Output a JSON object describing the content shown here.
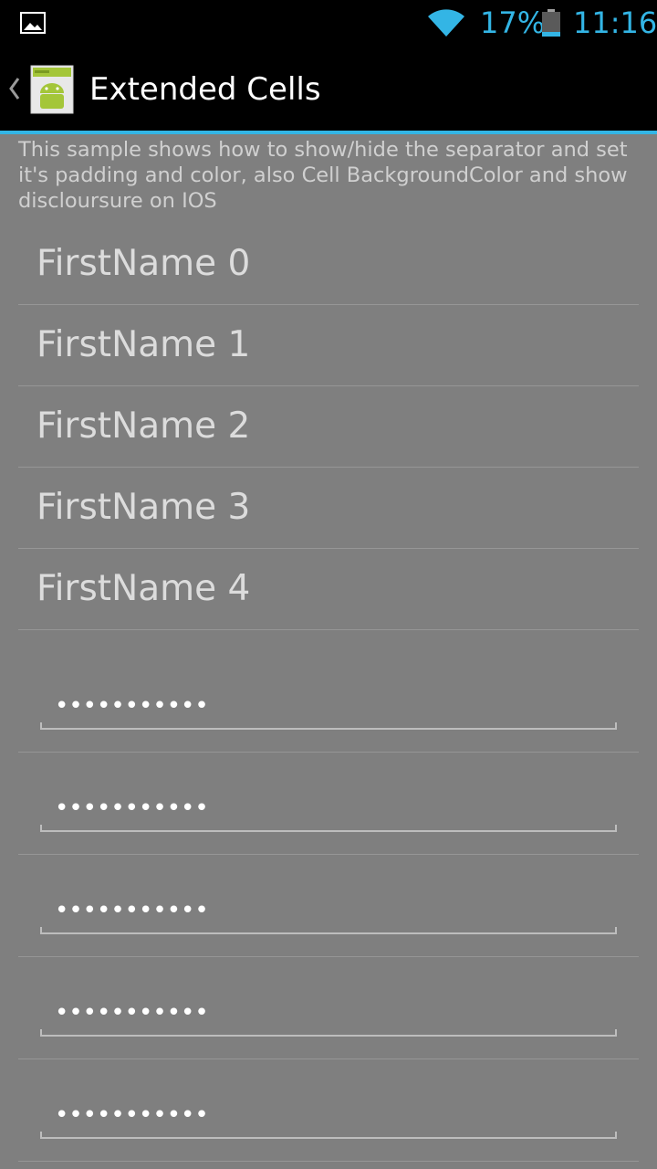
{
  "status_bar": {
    "left_icon": "image-icon",
    "wifi_icon": "wifi-icon",
    "battery_percent": "17%",
    "battery_icon": "battery-icon",
    "battery_level": 0.17,
    "time": "11:16",
    "accent_color": "#33b5e5"
  },
  "action_bar": {
    "up_icon": "chevron-left-icon",
    "app_icon": "android-app-icon",
    "title": "Extended Cells"
  },
  "description": "This sample shows how to show/hide the separator and set it's padding and color, also Cell BackgroundColor and show discloursure on IOS",
  "name_rows": [
    {
      "label": "FirstName 0"
    },
    {
      "label": "FirstName 1"
    },
    {
      "label": "FirstName 2"
    },
    {
      "label": "FirstName 3"
    },
    {
      "label": "FirstName 4"
    }
  ],
  "password_rows": [
    {
      "value": "•••••••••••"
    },
    {
      "value": "•••••••••••"
    },
    {
      "value": "•••••••••••"
    },
    {
      "value": "•••••••••••"
    },
    {
      "value": "•••••••••••"
    }
  ],
  "colors": {
    "background": "#7f7f7f",
    "bar_background": "#000000",
    "separator": "#969696"
  }
}
